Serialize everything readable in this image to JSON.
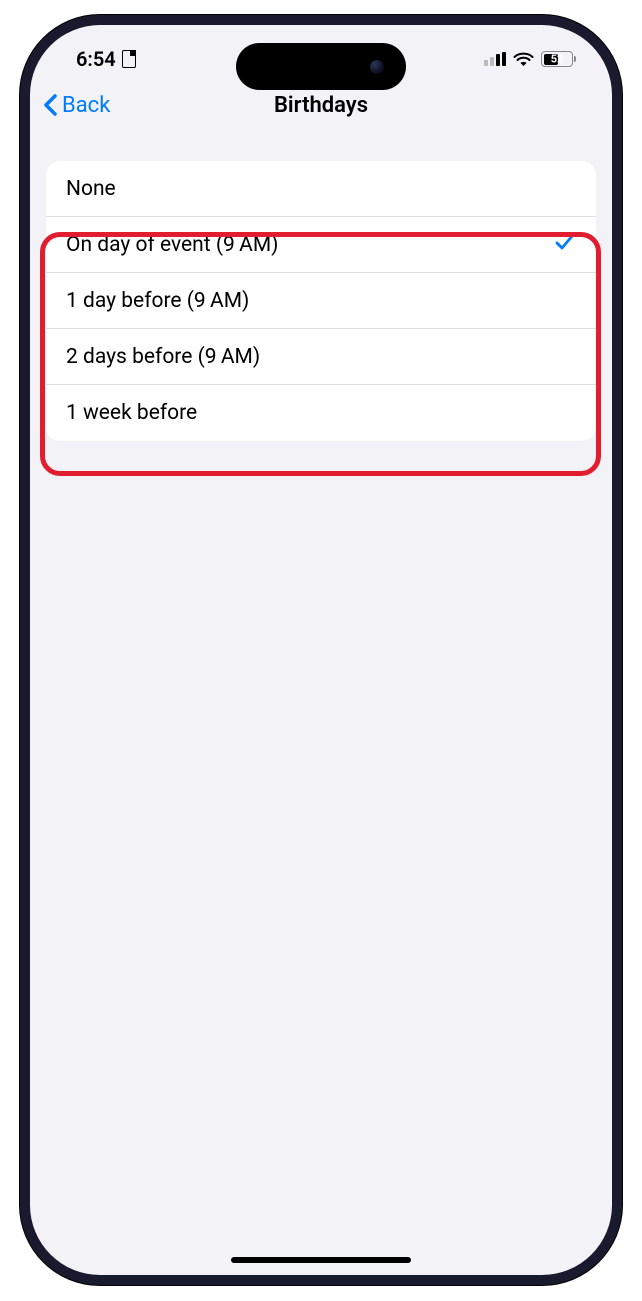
{
  "status": {
    "time": "6:54",
    "battery": "52"
  },
  "nav": {
    "back_label": "Back",
    "title": "Birthdays"
  },
  "options": [
    {
      "label": "None",
      "selected": false
    },
    {
      "label": "On day of event (9 AM)",
      "selected": true
    },
    {
      "label": "1 day before (9 AM)",
      "selected": false
    },
    {
      "label": "2 days before (9 AM)",
      "selected": false
    },
    {
      "label": "1 week before",
      "selected": false
    }
  ]
}
